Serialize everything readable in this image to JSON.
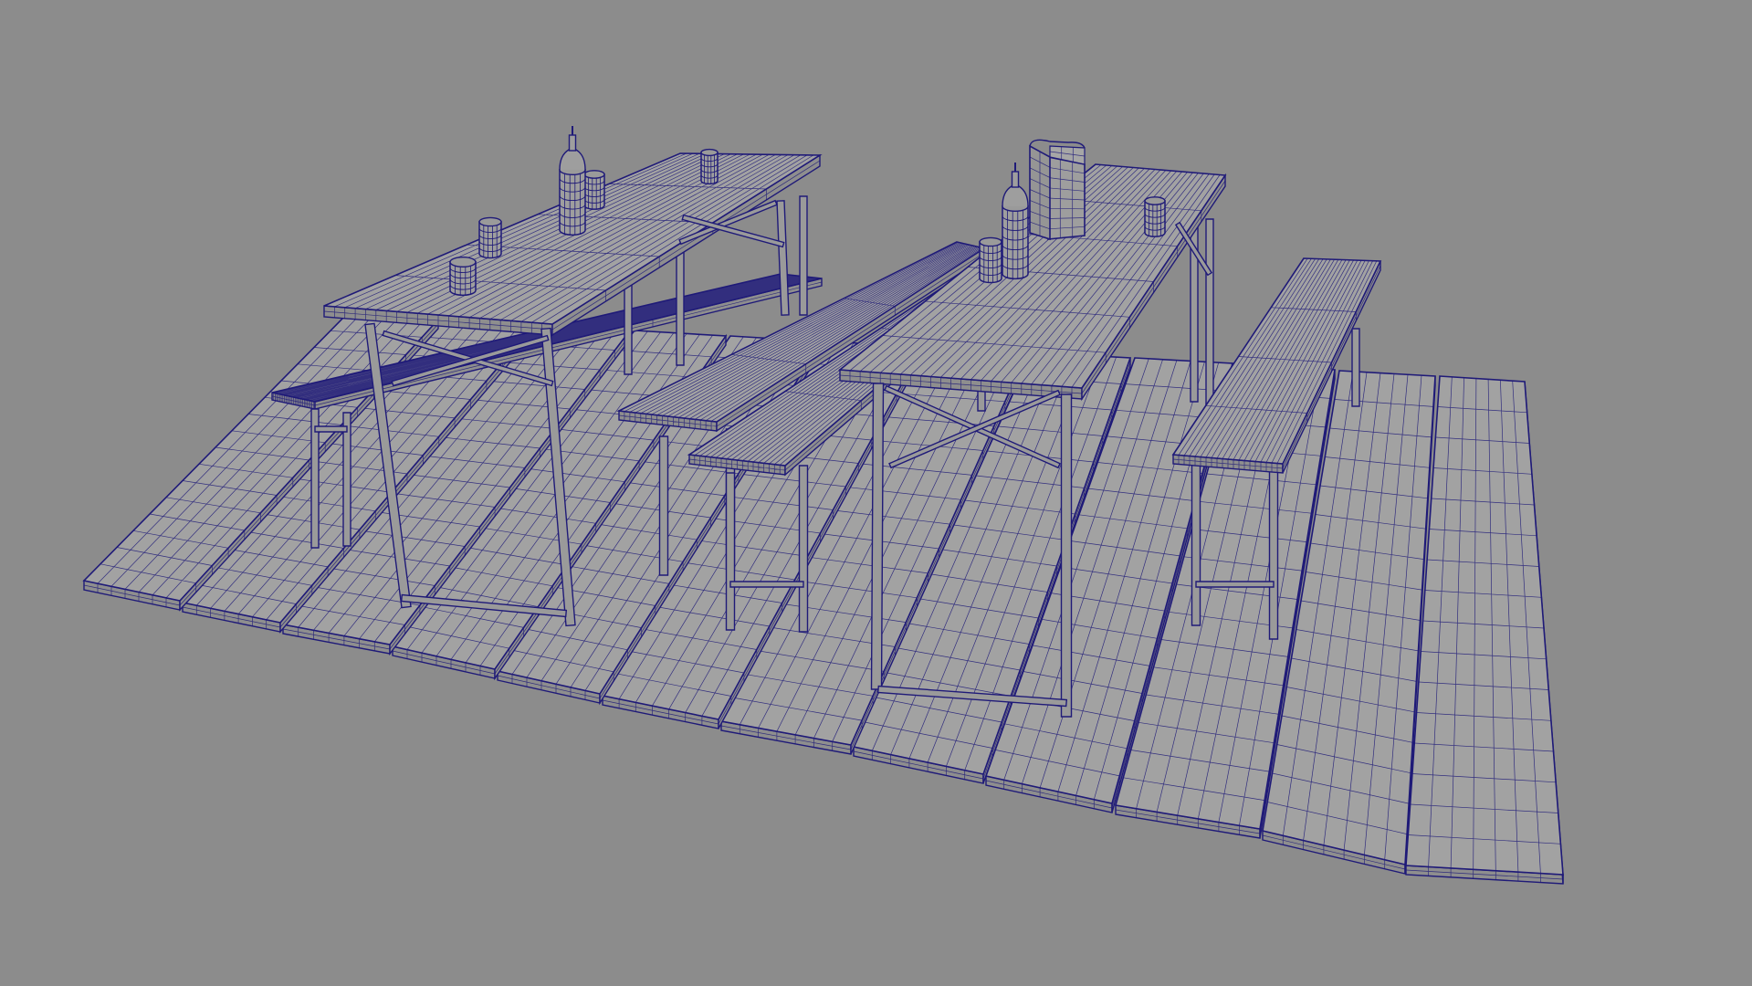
{
  "viewport": {
    "background_color": "#8c8c8c",
    "display_mode": "wireframe-on-shaded",
    "wire_color": "#1f1a78",
    "surface_color": "#a2a2a2",
    "surface_dark_color": "#8e8e8e",
    "objects": [
      "floor-planks",
      "left-table",
      "right-table",
      "benches",
      "bottles",
      "cans",
      "paper-bag"
    ]
  }
}
